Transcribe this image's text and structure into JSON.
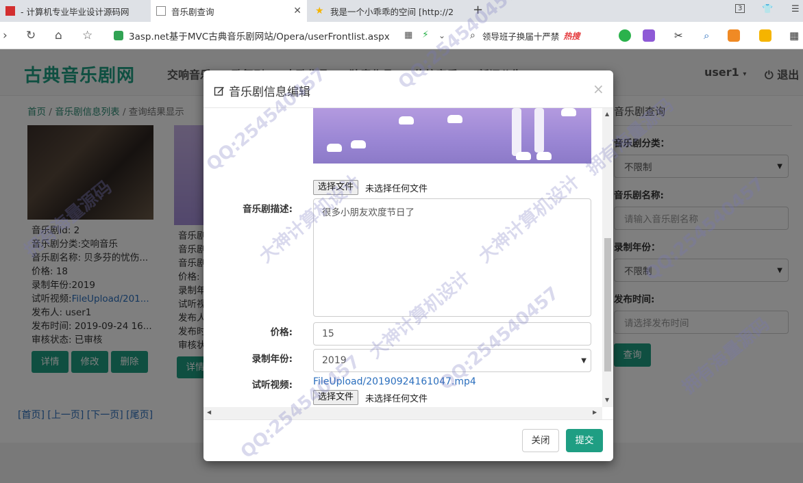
{
  "browser": {
    "tabs": [
      {
        "title": "- 计算机专业毕业设计源码网",
        "active": false
      },
      {
        "title": "音乐剧查询",
        "active": true
      },
      {
        "title": "我是一个小乖乖的空间 [http://2",
        "active": false
      }
    ],
    "url": "3asp.net基于MVC古典音乐剧网站/Opera/userFrontlist.aspx",
    "search_query": "领导班子换届十严禁",
    "hot_label": "热搜",
    "tab_count": "3"
  },
  "site": {
    "brand": "古典音乐剧网",
    "nav": [
      "交响音乐",
      "歌舞剧",
      "支歌作品",
      "独奏作品",
      "传统音乐",
      "新闻公告"
    ],
    "user": "user1",
    "logout": "退出"
  },
  "breadcrumb": [
    "首页",
    "音乐剧信息列表",
    "查询结果显示"
  ],
  "cards": [
    {
      "lines": [
        {
          "k": "音乐剧id: 2"
        },
        {
          "k": "音乐剧分类:交响音乐"
        },
        {
          "k": "音乐剧名称: 贝多芬的忧伤..."
        },
        {
          "k": "价格: 18"
        },
        {
          "k": "录制年份:2019"
        },
        {
          "k": "试听视频:",
          "link": "FileUpload/201..."
        },
        {
          "k": "发布人: user1"
        },
        {
          "k": "发布时间: 2019-09-24 16..."
        },
        {
          "k": "审核状态: 已审核"
        }
      ],
      "buttons": [
        "详情",
        "修改",
        "删除"
      ]
    },
    {
      "lines": [
        {
          "k": "音乐剧"
        },
        {
          "k": "音乐剧"
        },
        {
          "k": "音乐剧"
        },
        {
          "k": "价格:"
        },
        {
          "k": "录制年"
        },
        {
          "k": "试听视"
        },
        {
          "k": "发布人"
        },
        {
          "k": "发布时"
        },
        {
          "k": "审核状"
        }
      ],
      "buttons": [
        "详情"
      ]
    }
  ],
  "pager": "[首页] [上一页] [下一页] [尾页]",
  "sidebar": {
    "title": "音乐剧查询",
    "category_label": "音乐剧分类：",
    "category_value": "不限制",
    "name_label": "音乐剧名称:",
    "name_placeholder": "请输入音乐剧名称",
    "year_label": "录制年份：",
    "year_value": "不限制",
    "date_label": "发布时间:",
    "date_placeholder": "请选择发布时间",
    "query_button": "查询"
  },
  "modal": {
    "title": "音乐剧信息编辑",
    "close": "×",
    "choose_file": "选择文件",
    "no_file": "未选择任何文件",
    "desc_label": "音乐剧描述:",
    "desc_value": "很多小朋友欢度节日了",
    "price_label": "价格:",
    "price_value": "15",
    "year_label": "录制年份:",
    "year_value": "2019",
    "video_label": "试听视频:",
    "video_link": "FileUpload/20190924161047.mp4",
    "close_button": "关闭",
    "submit_button": "提交"
  },
  "watermarks": [
    "QQ:254540457",
    "大神计算机设计",
    "拥有海量源码"
  ],
  "colors": {
    "accent": "#1f9e83",
    "link": "#2a6ebd"
  }
}
